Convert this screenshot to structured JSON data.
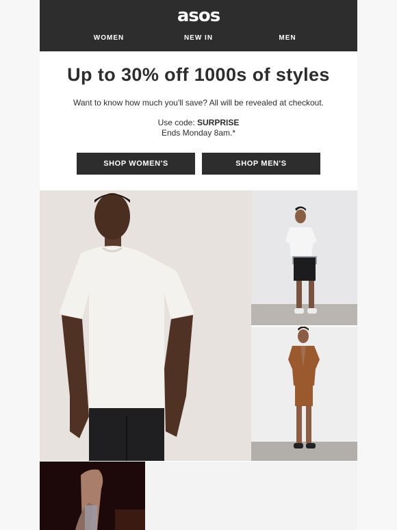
{
  "header": {
    "logo": "asos",
    "nav": [
      {
        "label": "WOMEN"
      },
      {
        "label": "NEW IN"
      },
      {
        "label": "MEN"
      }
    ]
  },
  "hero": {
    "headline": "Up to 30% off 1000s of styles",
    "subtext": "Want to know how much you'll save? All will be revealed at checkout.",
    "code_prefix": "Use code: ",
    "code": "SURPRISE",
    "ends": "Ends Monday 8am.*"
  },
  "buttons": {
    "women": "SHOP WOMEN'S",
    "men": "SHOP MEN'S"
  },
  "colors": {
    "header_bg": "#2d2d2d",
    "button_bg": "#2d2d2d",
    "page_bg": "#f7f7f7"
  }
}
